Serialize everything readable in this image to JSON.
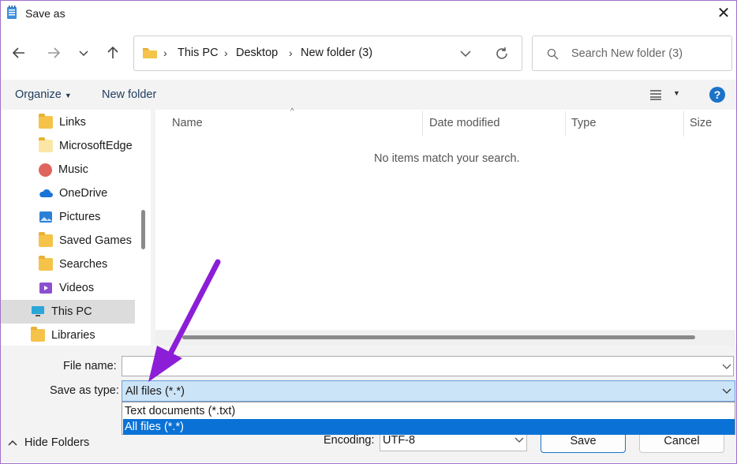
{
  "window": {
    "title": "Save as",
    "close_glyph": "✕"
  },
  "nav": {
    "back_icon": "arrow-left-icon",
    "forward_icon": "arrow-right-icon",
    "recent_icon": "chevron-down-icon",
    "up_icon": "arrow-up-icon"
  },
  "address": {
    "crumbs": [
      "This PC",
      "Desktop",
      "New folder (3)"
    ],
    "separator": "›"
  },
  "search": {
    "placeholder": "Search New folder (3)"
  },
  "toolbar": {
    "organize_label": "Organize",
    "new_folder_label": "New folder",
    "help_label": "?"
  },
  "sidebar": {
    "items": [
      {
        "label": "Links",
        "icon": "folder-icon"
      },
      {
        "label": "MicrosoftEdge",
        "icon": "folder-icon"
      },
      {
        "label": "Music",
        "icon": "music-icon"
      },
      {
        "label": "OneDrive",
        "icon": "cloud-icon"
      },
      {
        "label": "Pictures",
        "icon": "pictures-icon"
      },
      {
        "label": "Saved Games",
        "icon": "folder-icon"
      },
      {
        "label": "Searches",
        "icon": "folder-icon"
      },
      {
        "label": "Videos",
        "icon": "videos-icon"
      },
      {
        "label": "This PC",
        "icon": "computer-icon",
        "selected": true
      },
      {
        "label": "Libraries",
        "icon": "folder-icon"
      }
    ]
  },
  "file_list": {
    "columns": [
      "Name",
      "Date modified",
      "Type",
      "Size"
    ],
    "empty_message": "No items match your search."
  },
  "form": {
    "file_name_label": "File name:",
    "file_name_value": "",
    "save_type_label": "Save as type:",
    "save_type_value": "All files  (*.*)",
    "type_options": [
      "Text documents (*.txt)",
      "All files  (*.*)"
    ],
    "selected_option_index": 1,
    "encoding_label": "Encoding:",
    "encoding_value": "UTF-8",
    "save_label": "Save",
    "cancel_label": "Cancel",
    "hide_folders_label": "Hide Folders"
  },
  "colors": {
    "accent": "#0a72d6",
    "annotation_arrow": "#8b1ed6"
  }
}
